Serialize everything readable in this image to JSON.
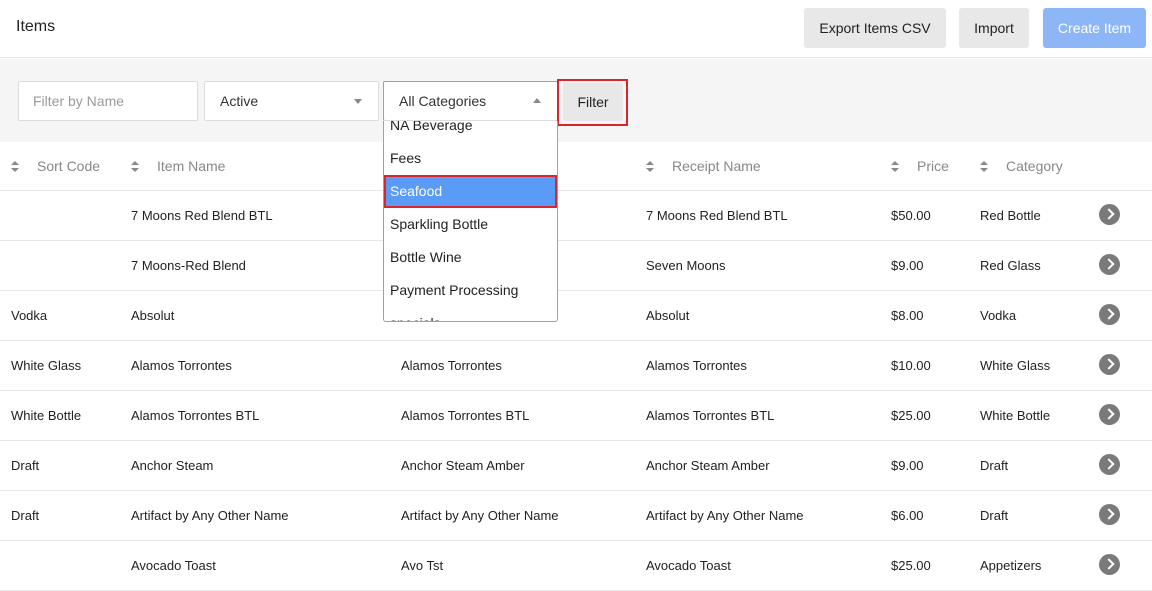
{
  "header": {
    "title": "Items",
    "export_label": "Export Items CSV",
    "import_label": "Import",
    "create_label": "Create Item"
  },
  "filters": {
    "name_placeholder": "Filter by Name",
    "status_value": "Active",
    "category_value": "All Categories",
    "filter_label": "Filter"
  },
  "category_dropdown": {
    "options": [
      "NA Beverage",
      "Fees",
      "Seafood",
      "Sparkling Bottle",
      "Bottle Wine",
      "Payment Processing",
      "specials"
    ],
    "selected": "Seafood"
  },
  "table": {
    "columns": {
      "sort_code": "Sort Code",
      "item_name": "Item Name",
      "receipt_name": "Receipt Name",
      "price": "Price",
      "category": "Category"
    },
    "rows": [
      {
        "sort_code": "",
        "item_name": "7 Moons Red Blend BTL",
        "short_name": "",
        "receipt_name": "7 Moons Red Blend BTL",
        "price": "$50.00",
        "category": "Red Bottle"
      },
      {
        "sort_code": "",
        "item_name": "7 Moons-Red Blend",
        "short_name": "",
        "receipt_name": "Seven Moons",
        "price": "$9.00",
        "category": "Red Glass"
      },
      {
        "sort_code": "Vodka",
        "item_name": "Absolut",
        "short_name": "",
        "receipt_name": "Absolut",
        "price": "$8.00",
        "category": "Vodka"
      },
      {
        "sort_code": "White Glass",
        "item_name": "Alamos Torrontes",
        "short_name": "Alamos Torrontes",
        "receipt_name": "Alamos Torrontes",
        "price": "$10.00",
        "category": "White Glass"
      },
      {
        "sort_code": "White Bottle",
        "item_name": "Alamos Torrontes BTL",
        "short_name": "Alamos Torrontes BTL",
        "receipt_name": "Alamos Torrontes BTL",
        "price": "$25.00",
        "category": "White Bottle"
      },
      {
        "sort_code": "Draft",
        "item_name": "Anchor Steam",
        "short_name": "Anchor Steam Amber",
        "receipt_name": "Anchor Steam Amber",
        "price": "$9.00",
        "category": "Draft"
      },
      {
        "sort_code": "Draft",
        "item_name": "Artifact by Any Other Name",
        "short_name": "Artifact by Any Other Name",
        "receipt_name": "Artifact by Any Other Name",
        "price": "$6.00",
        "category": "Draft"
      },
      {
        "sort_code": "",
        "item_name": "Avocado Toast",
        "short_name": "Avo Tst",
        "receipt_name": "Avocado Toast",
        "price": "$25.00",
        "category": "Appetizers"
      }
    ]
  },
  "colors": {
    "primary": "#8db6f7",
    "selected_option": "#5b9bf8",
    "highlight_outline": "#d9262b"
  }
}
